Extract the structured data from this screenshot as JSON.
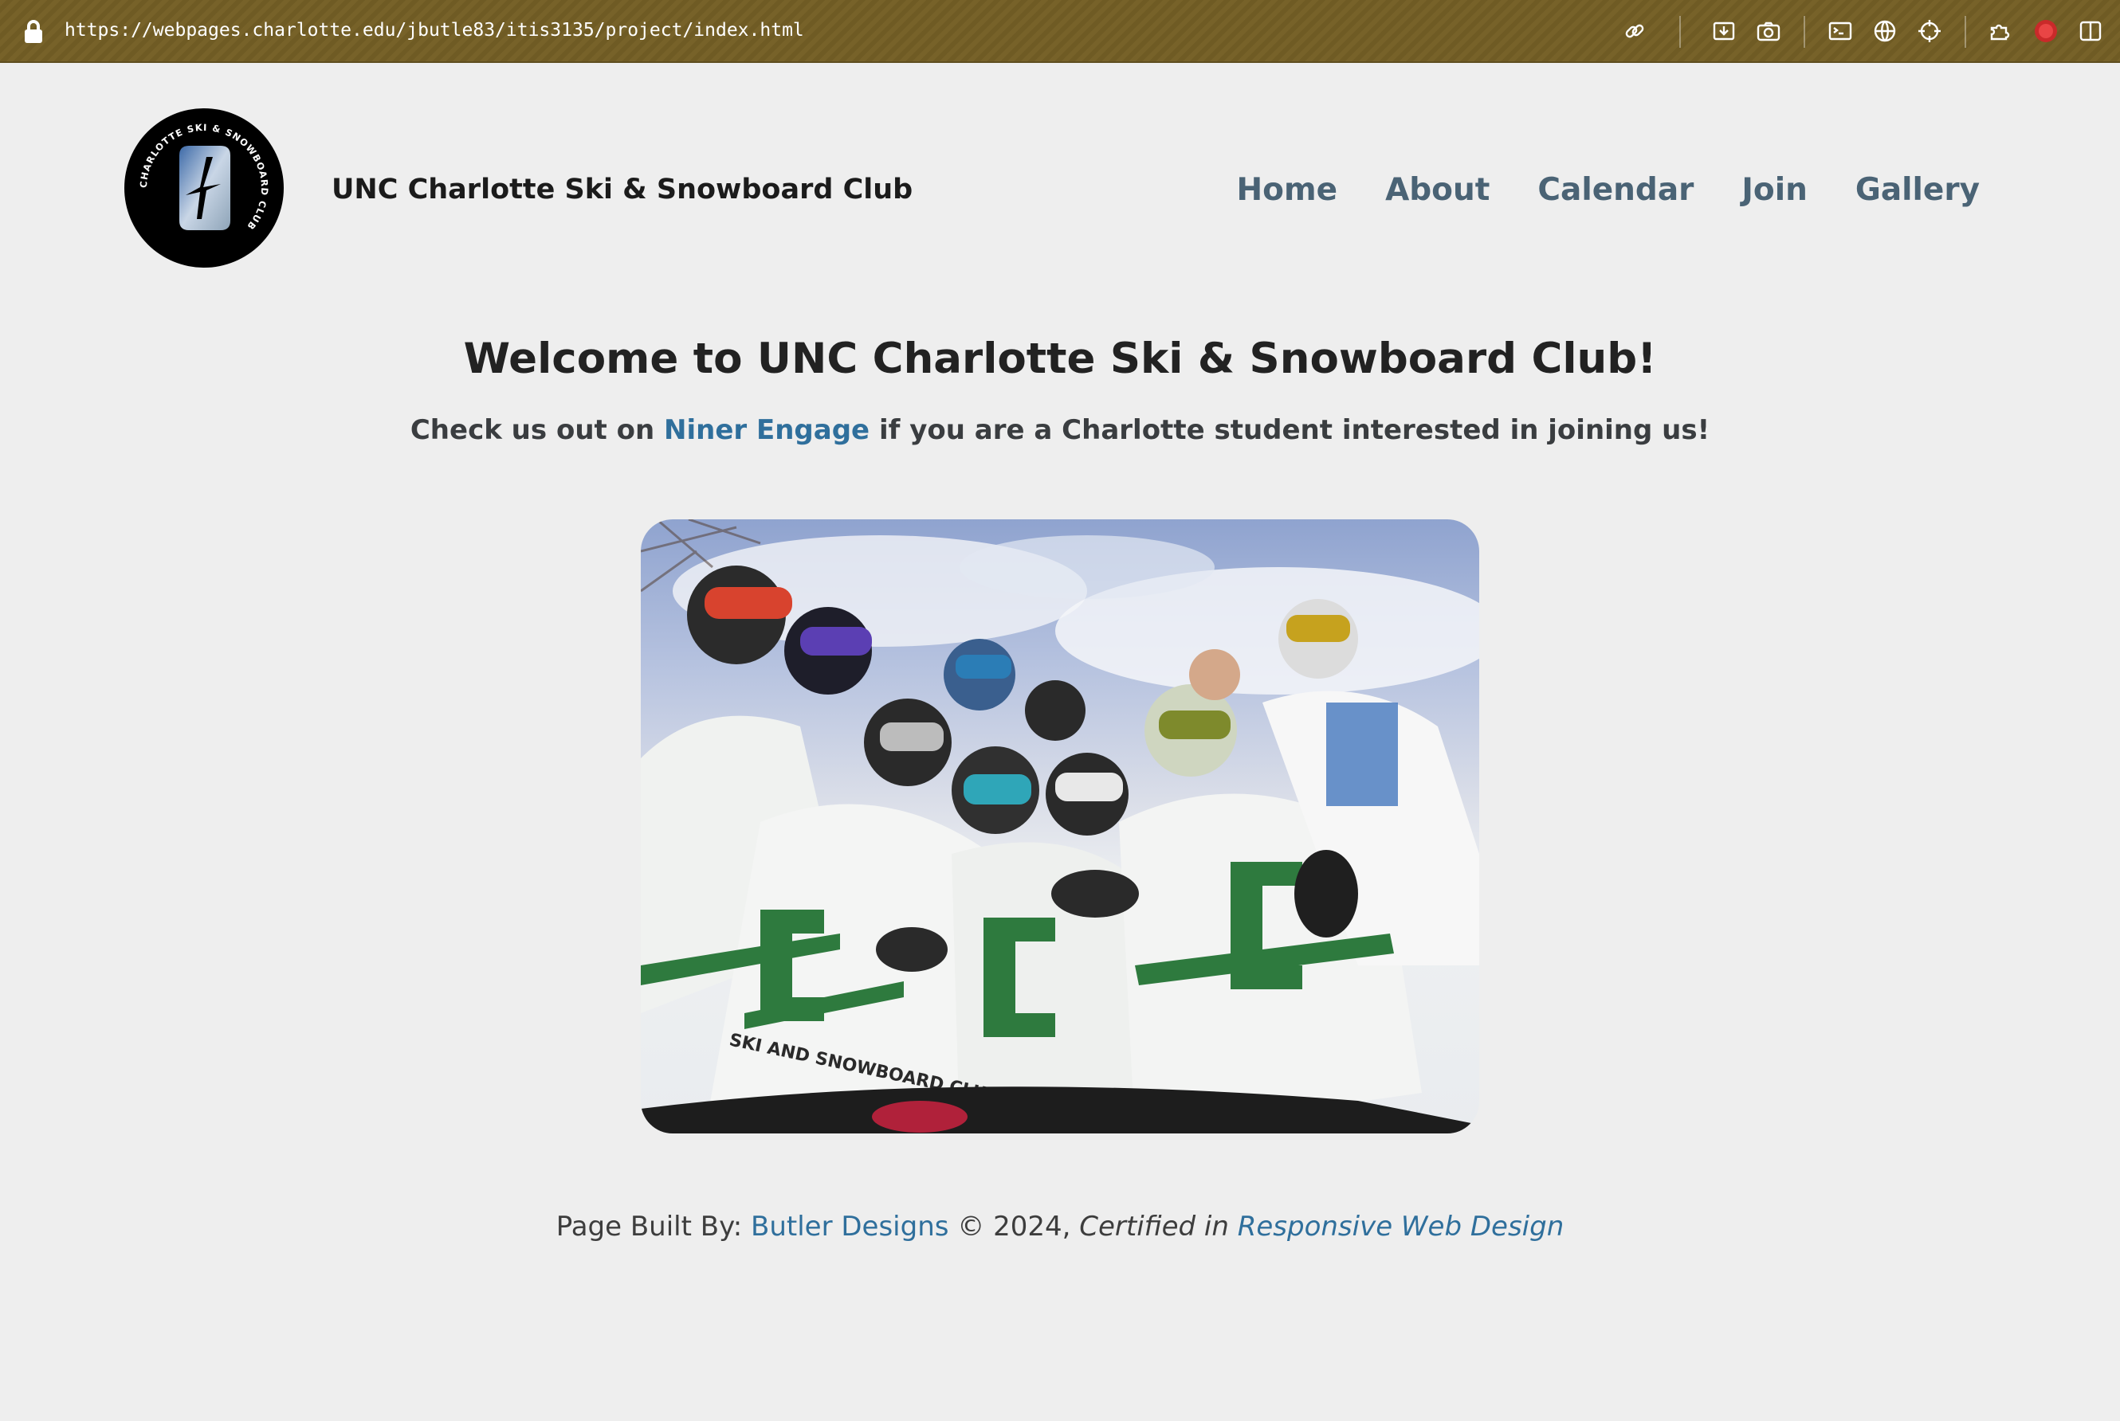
{
  "browser": {
    "url": "https://webpages.charlotte.edu/jbutle83/itis3135/project/index.html",
    "icons": [
      "link-icon",
      "download-icon",
      "camera-icon",
      "terminal-icon",
      "globe-icon",
      "crosshair-icon",
      "extensions-icon",
      "record-icon",
      "sidebar-icon"
    ]
  },
  "header": {
    "logo_text": "CHARLOTTE SKI & SNOWBOARD CLUB",
    "title": "UNC Charlotte Ski & Snowboard Club",
    "nav": [
      {
        "label": "Home"
      },
      {
        "label": "About"
      },
      {
        "label": "Calendar"
      },
      {
        "label": "Join"
      },
      {
        "label": "Gallery"
      }
    ]
  },
  "main": {
    "heading": "Welcome to UNC Charlotte Ski & Snowboard Club!",
    "intro_before": "Check us out on ",
    "intro_link": "Niner Engage",
    "intro_after": " if you are a Charlotte student interested in joining us!",
    "photo_jersey_text": "SKI AND SNOWBOARD CLUB"
  },
  "footer": {
    "built_by": "Page Built By: ",
    "designer_link": "Butler Designs",
    "copyright": " © 2024, ",
    "certified": "Certified in ",
    "cert_link": "Responsive Web Design"
  },
  "colors": {
    "toolbar": "#776229",
    "nav_link": "#4a6375",
    "link": "#2f6f9c",
    "background": "#eeeeee"
  }
}
